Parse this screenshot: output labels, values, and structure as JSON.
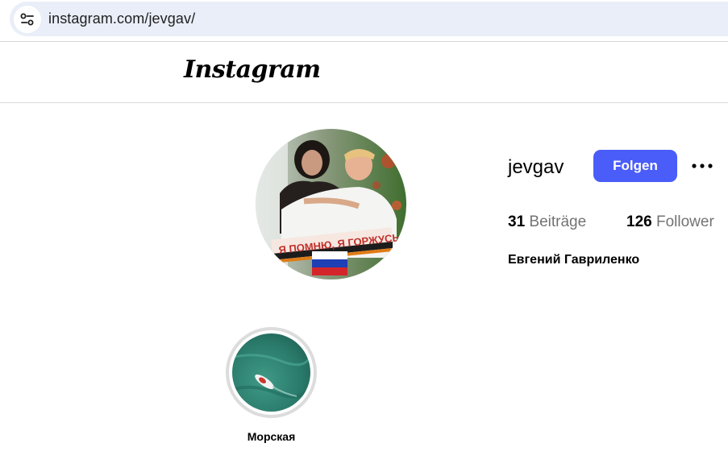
{
  "browser": {
    "url": "instagram.com/jevgav/",
    "site_info_icon": "tune-icon"
  },
  "header": {
    "logo_text": "Instagram"
  },
  "profile": {
    "avatar_banner_text": "Я ПОМНЮ, Я ГОРЖУСЬ!",
    "username": "jevgav",
    "follow_label": "Folgen",
    "more_icon": "more-horizontal-icon",
    "posts_count": "31",
    "posts_label": "Beiträge",
    "followers_count": "126",
    "followers_label": "Follower",
    "full_name": "Евгений Гавриленко"
  },
  "highlights": [
    {
      "label": "Морская"
    }
  ],
  "colors": {
    "follow_button": "#4a5df9",
    "url_bar": "#e9eef8",
    "muted_text": "#737373"
  }
}
